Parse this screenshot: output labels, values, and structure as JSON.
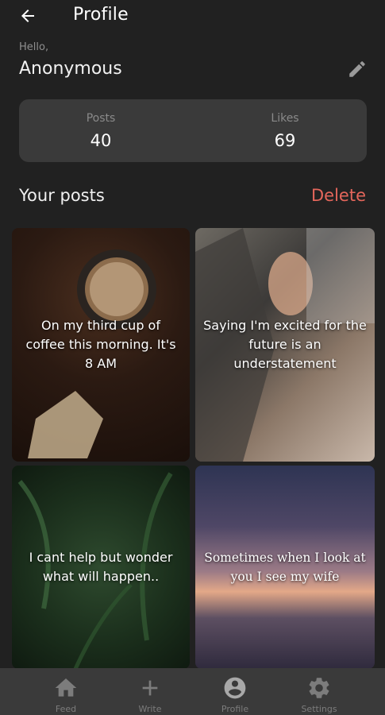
{
  "header": {
    "title": "Profile",
    "back_icon": "arrow-left-icon"
  },
  "greeting": {
    "hello": "Hello,",
    "username": "Anonymous",
    "edit_icon": "pencil-icon"
  },
  "stats": {
    "posts_label": "Posts",
    "posts_value": "40",
    "likes_label": "Likes",
    "likes_value": "69"
  },
  "posts_section": {
    "title": "Your posts",
    "delete_label": "Delete"
  },
  "posts": [
    {
      "text": "On my third cup of coffee this morning. It's 8 AM"
    },
    {
      "text": "Saying I'm excited for the future is an understatement"
    },
    {
      "text": "I cant help but wonder what will happen.."
    },
    {
      "text": "Sometimes when I look at you I see my wife"
    }
  ],
  "nav": [
    {
      "label": "Feed",
      "icon": "home-icon"
    },
    {
      "label": "Write",
      "icon": "plus-icon"
    },
    {
      "label": "Profile",
      "icon": "account-circle-icon"
    },
    {
      "label": "Settings",
      "icon": "gear-icon"
    }
  ],
  "colors": {
    "background": "#212121",
    "surface": "#3a3a3a",
    "accent_delete": "#e4665b",
    "muted_text": "#8a8a8a",
    "nav_inactive": "#7c7c7c",
    "nav_active": "#a8a8a8"
  }
}
